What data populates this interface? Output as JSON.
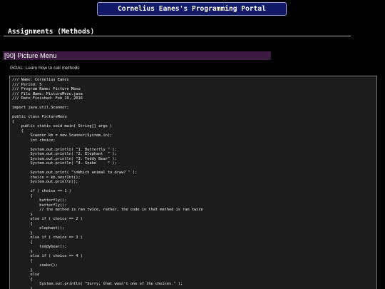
{
  "header": {
    "portal_title": "Cornelius Eanes's Programming Portal"
  },
  "section": {
    "heading": "Assignments (Methods)"
  },
  "assignment": {
    "title": "[90] Picture Menu",
    "goal": "GOAL: Learn how to call methods"
  },
  "code": {
    "lines": [
      "/// Name: Cornelius Eanes",
      "/// Period: 5",
      "/// Program Name: Picture Menu",
      "/// File Name: PictureMenu.java",
      "/// Date Finished: Feb 19, 2016",
      "",
      "import java.util.Scanner;",
      "",
      "public class PictureMenu",
      "{",
      "    public static void main( String[] args )",
      "    {",
      "        Scanner kb = new Scanner(System.in);",
      "        int choice;",
      "",
      "        System.out.println( \"1. Butterfly \" );",
      "        System.out.println( \"2. Elephant  \" );",
      "        System.out.println( \"3. Teddy Bear\" );",
      "        System.out.println( \"4. Snake     \" );",
      "",
      "        System.out.print( \"\\nWhich animal to draw? \" );",
      "        choice = kb.nextInt();",
      "        System.out.println();",
      "",
      "        if ( choice == 1 )",
      "        {",
      "            butterfly();",
      "            butterfly();",
      "            // the method is ran twice, rather, the code in that method is ran twice",
      "        }",
      "        else if ( choice == 2 )",
      "        {",
      "            elephant();",
      "        }",
      "        else if ( choice == 3 )",
      "        {",
      "            teddybear();",
      "        }",
      "        else if ( choice == 4 )",
      "        {",
      "            snake();",
      "        }",
      "        else",
      "        {",
      "            System.out.println( \"Sorry, that wasn't one of the choices.\" );",
      "        }"
    ]
  }
}
